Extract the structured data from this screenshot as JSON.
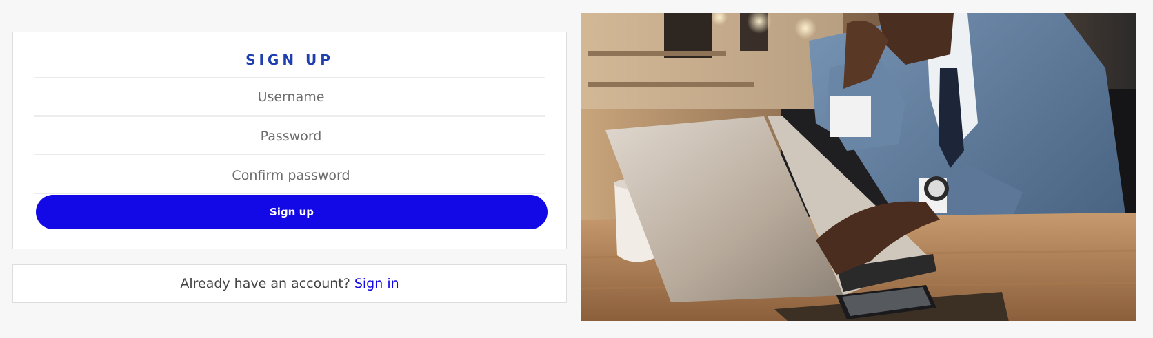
{
  "signup": {
    "title": "SIGN UP",
    "username_placeholder": "Username",
    "password_placeholder": "Password",
    "confirm_placeholder": "Confirm password",
    "submit_label": "Sign up"
  },
  "signin": {
    "prompt": "Already have an account?",
    "link_label": "Sign in"
  },
  "colors": {
    "accent": "#1309e6",
    "title": "#1f3fb0",
    "background": "#f7f7f7"
  }
}
